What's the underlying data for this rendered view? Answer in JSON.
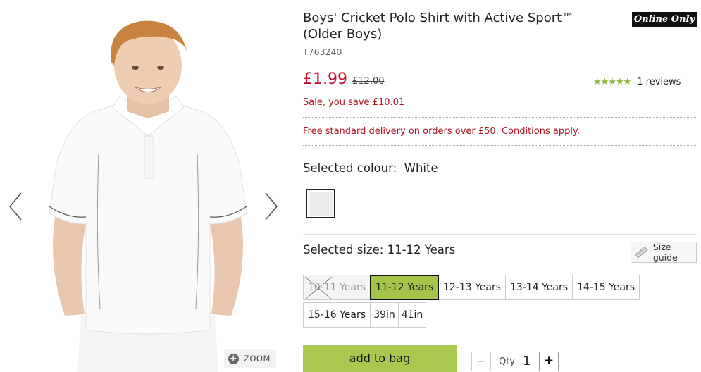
{
  "product": {
    "title": "Boys' Cricket Polo Shirt with Active Sport™ (Older Boys)",
    "badge": "Online Only",
    "sku": "T763240",
    "price": "£1.99",
    "was_price": "£12.00",
    "saving": "Sale, you save £10.01",
    "rating": {
      "stars": "★★★★★",
      "value": 5,
      "reviews_label": "1 reviews"
    },
    "delivery_text": "Free standard delivery on orders over £50. Conditions apply."
  },
  "colour": {
    "label": "Selected colour:",
    "value": "White",
    "swatch_color": "#eeeeee"
  },
  "size": {
    "label": "Selected size:",
    "value": "11-12 Years",
    "guide_label": "Size guide",
    "options_row1": [
      "10-11 Years",
      "11-12 Years",
      "12-13 Years",
      "13-14 Years",
      "14-15 Years"
    ],
    "options_row2": [
      "15-16 Years",
      "39in",
      "41in"
    ],
    "unavailable": [
      "10-11 Years"
    ],
    "selected": "11-12 Years"
  },
  "gallery": {
    "zoom_label": "ZOOM",
    "prev_icon": "chevron-left-icon",
    "next_icon": "chevron-right-icon"
  },
  "purchase": {
    "add_to_bag_label": "add to bag",
    "qty_label": "Qty",
    "qty_value": "1",
    "minus": "−",
    "plus": "+"
  },
  "colors": {
    "price_red": "#c8102e",
    "accent_green": "#a8c84f",
    "star_green": "#8cb33a"
  }
}
